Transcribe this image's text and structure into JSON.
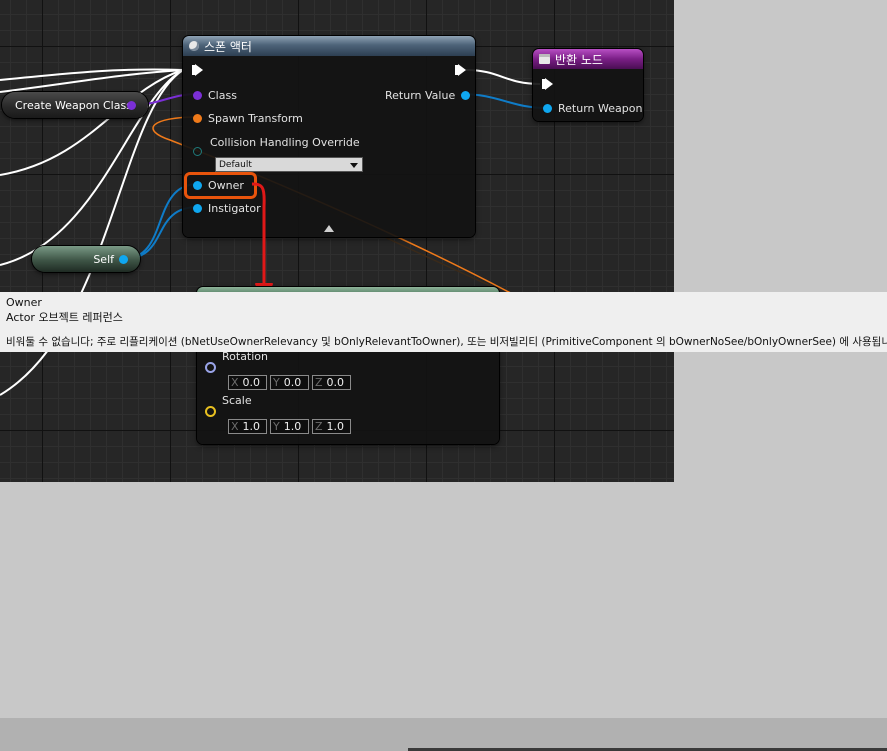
{
  "spawn_node": {
    "title": "스폰 액터",
    "pins": {
      "class": "Class",
      "spawn_transform": "Spawn Transform",
      "collision": "Collision Handling Override",
      "collision_value": "Default",
      "owner": "Owner",
      "instigator": "Instigator",
      "return_value": "Return Value"
    }
  },
  "return_node": {
    "title": "반환 노드",
    "pin": "Return Weapon"
  },
  "variables": {
    "create_weapon_class": "Create Weapon Class",
    "self": "Self"
  },
  "transform_node": {
    "rotation_label": "Rotation",
    "rotation": {
      "x": "0.0",
      "y": "0.0",
      "z": "0.0"
    },
    "scale_label": "Scale",
    "scale": {
      "x": "1.0",
      "y": "1.0",
      "z": "1.0"
    },
    "axes": {
      "x": "X",
      "y": "Y",
      "z": "Z"
    }
  },
  "tooltip": {
    "title": "Owner",
    "type": "Actor 오브젝트 레퍼런스",
    "description": "비워둘 수 없습니다; 주로 리플리케이션 (bNetUseOwnerRelevancy 및 bOnlyRelevantToOwner), 또는 비저빌리티 (PrimitiveComponent 의 bOwnerNoSee/bOnlyOwnerSee) 에 사용됩니다."
  },
  "colors": {
    "class_pin": "#7b2fd6",
    "object_pin": "#0fa7f0",
    "struct_pin": "#f07a1a",
    "rotator_pin": "#9aa4e8",
    "vector_pin": "#e8c020",
    "annotation": "#e03010",
    "arrow": "#e01818"
  }
}
